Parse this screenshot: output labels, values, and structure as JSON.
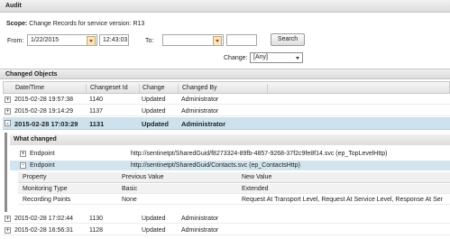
{
  "panel": {
    "title": "Audit"
  },
  "scope": {
    "label": "Scope:",
    "text": "Change Records for service version: R13"
  },
  "filter": {
    "from_label": "From:",
    "from_date": "1/22/2015",
    "from_time": "12:43:03",
    "to_label": "To:",
    "to_date": "",
    "to_time": "",
    "search_label": "Search",
    "change_label": "Change:",
    "change_value": "[Any]"
  },
  "section": {
    "title": "Changed Objects"
  },
  "columns": [
    "Date/Time",
    "Changeset Id",
    "Change",
    "Changed By"
  ],
  "rows": [
    {
      "toggle": "+",
      "datetime": "2015-02-28 19:57:38",
      "changeset": "1140",
      "change": "Updated",
      "by": "Administrator"
    },
    {
      "toggle": "+",
      "datetime": "2015-02-28 19:14:29",
      "changeset": "1137",
      "change": "Updated",
      "by": "Administrator"
    },
    {
      "toggle": "-",
      "datetime": "2015-02-28 17:03:29",
      "changeset": "1131",
      "change": "Updated",
      "by": "Administrator"
    },
    {
      "toggle": "+",
      "datetime": "2015-02-28 17:02:44",
      "changeset": "1130",
      "change": "Updated",
      "by": "Administrator"
    },
    {
      "toggle": "+",
      "datetime": "2015-02-28 16:56:31",
      "changeset": "1128",
      "change": "Updated",
      "by": "Administrator"
    }
  ],
  "detail": {
    "title": "What changed",
    "endpoints": [
      {
        "toggle": "+",
        "label": "Endpoint",
        "value": "http://sentinetpt/SharedGuid/f8273324-89fb-4857-9268-37f2c9fe8f14.svc (ep_TopLevelHttp)"
      },
      {
        "toggle": "-",
        "label": "Endpoint",
        "value": "http://sentinetpt/SharedGuid/Contacts.svc (ep_ContactsHttp)"
      }
    ],
    "columns": [
      "Property",
      "Previous Value",
      "New Value"
    ],
    "rows": [
      {
        "property": "Monitoring Type",
        "previous": "Basic",
        "new": "Extended"
      },
      {
        "property": "Recording Points",
        "previous": "None",
        "new": "Request At Transport Level, Request At Service Level, Response At Ser"
      }
    ]
  }
}
